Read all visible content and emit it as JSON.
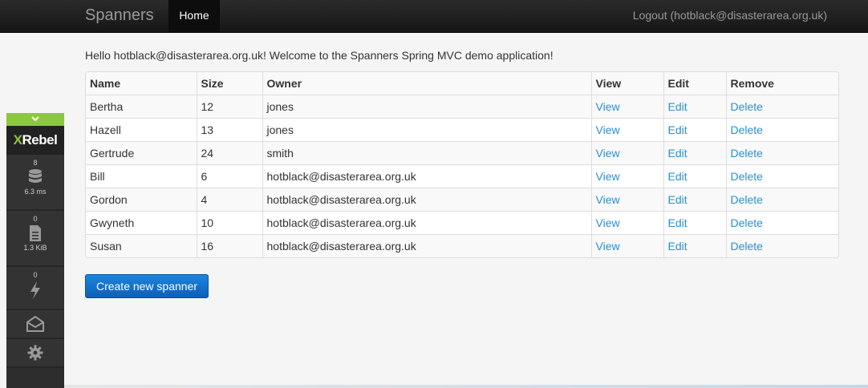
{
  "navbar": {
    "brand": "Spanners",
    "home_label": "Home",
    "logout_label": "Logout (hotblack@disasterarea.org.uk)"
  },
  "main": {
    "welcome": "Hello hotblack@disasterarea.org.uk! Welcome to the Spanners Spring MVC demo application!",
    "table": {
      "headers": [
        "Name",
        "Size",
        "Owner",
        "View",
        "Edit",
        "Remove"
      ],
      "rows": [
        {
          "name": "Bertha",
          "size": "12",
          "owner": "jones",
          "view": "View",
          "edit": "Edit",
          "remove": "Delete"
        },
        {
          "name": "Hazell",
          "size": "13",
          "owner": "jones",
          "view": "View",
          "edit": "Edit",
          "remove": "Delete"
        },
        {
          "name": "Gertrude",
          "size": "24",
          "owner": "smith",
          "view": "View",
          "edit": "Edit",
          "remove": "Delete"
        },
        {
          "name": "Bill",
          "size": "6",
          "owner": "hotblack@disasterarea.org.uk",
          "view": "View",
          "edit": "Edit",
          "remove": "Delete"
        },
        {
          "name": "Gordon",
          "size": "4",
          "owner": "hotblack@disasterarea.org.uk",
          "view": "View",
          "edit": "Edit",
          "remove": "Delete"
        },
        {
          "name": "Gwyneth",
          "size": "10",
          "owner": "hotblack@disasterarea.org.uk",
          "view": "View",
          "edit": "Edit",
          "remove": "Delete"
        },
        {
          "name": "Susan",
          "size": "16",
          "owner": "hotblack@disasterarea.org.uk",
          "view": "View",
          "edit": "Edit",
          "remove": "Delete"
        }
      ]
    },
    "create_button": "Create new spanner"
  },
  "xrebel": {
    "logo_x": "X",
    "logo_rest": "Rebel",
    "db": {
      "count": "8",
      "value": "6.3 ms",
      "icon": "database-icon"
    },
    "io": {
      "count": "0",
      "value": "1.3 KiB",
      "icon": "document-icon"
    },
    "exceptions": {
      "count": "0",
      "icon": "lightning-icon"
    },
    "mail_icon": "envelope-icon",
    "settings_icon": "gear-icon"
  },
  "colors": {
    "navbar_bg": "#1b1b1b",
    "link": "#2a8fd0",
    "primary_button": "#0d6fd0",
    "xrebel_green": "#8dc63f"
  }
}
